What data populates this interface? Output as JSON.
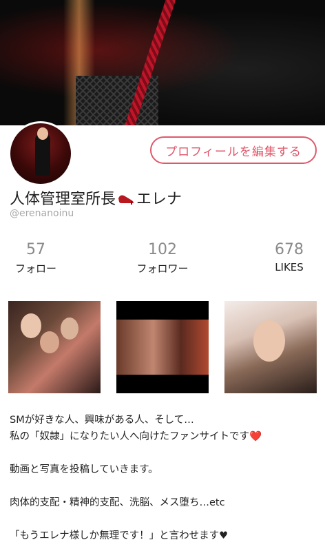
{
  "profile": {
    "edit_button": "プロフィールを編集する",
    "name_part1": "人体管理室所長",
    "name_part2": "エレナ",
    "name_icon": "high-heel-icon",
    "handle": "@erenanoinu"
  },
  "stats": [
    {
      "count": "57",
      "label": "フォロー"
    },
    {
      "count": "102",
      "label": "フォロワー"
    },
    {
      "count": "678",
      "label": "LIKES"
    }
  ],
  "bio": {
    "line1": "SMが好きな人、興味がある人、そして…",
    "line2": "私の「奴隷」になりたい人へ向けたファンサイトです",
    "line3": "動画と写真を投稿していきます。",
    "line4": "肉体的支配・精神的支配、洗脳、メス堕ち…etc",
    "line5": "「もうエレナ様しか無理です！」と言わせます"
  },
  "colors": {
    "accent": "#e0576b",
    "muted": "#a8a8a8"
  }
}
